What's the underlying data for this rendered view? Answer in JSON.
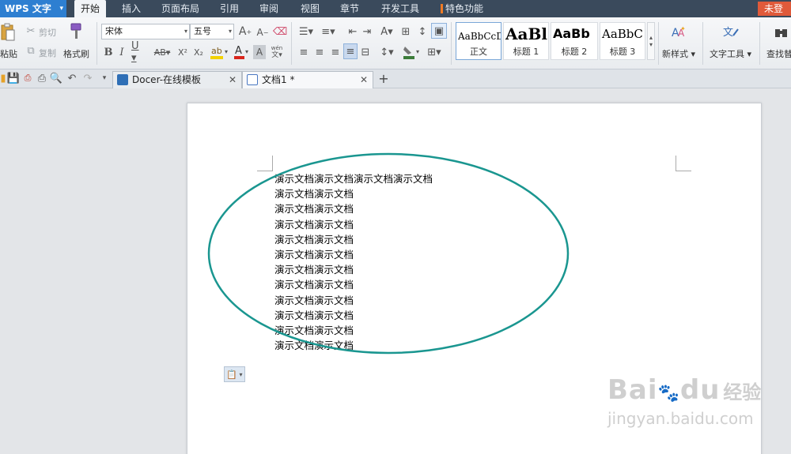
{
  "app": {
    "name": "WPS 文字",
    "login_label": "未登录"
  },
  "menu": {
    "tabs": [
      "开始",
      "插入",
      "页面布局",
      "引用",
      "审阅",
      "视图",
      "章节",
      "开发工具",
      "特色功能"
    ],
    "active": "开始"
  },
  "ribbon": {
    "clipboard": {
      "paste": "粘贴",
      "cut": "剪切",
      "copy": "复制",
      "format_painter": "格式刷"
    },
    "font": {
      "name": "宋体",
      "size": "五号"
    },
    "styles": [
      {
        "preview": "AaBbCcDd",
        "name": "正文"
      },
      {
        "preview": "AaBl",
        "name": "标题 1"
      },
      {
        "preview": "AaBb",
        "name": "标题 2"
      },
      {
        "preview": "AaBbC",
        "name": "标题 3"
      }
    ],
    "new_style": "新样式",
    "text_tools": "文字工具",
    "find_replace": "查找替"
  },
  "tabs": [
    {
      "label": "Docer-在线模板",
      "active": false
    },
    {
      "label": "文档1 *",
      "active": true
    }
  ],
  "document": {
    "lines": [
      "演示文档演示文档演示文档演示文档",
      "演示文档演示文档",
      "演示文档演示文档",
      "演示文档演示文档",
      "演示文档演示文档",
      "演示文档演示文档",
      "演示文档演示文档",
      "演示文档演示文档",
      "演示文档演示文档",
      "演示文档演示文档",
      "演示文档演示文档",
      "演示文档演示文档"
    ],
    "ellipse_color": "#1a9690"
  },
  "watermark": {
    "brand": "Bai",
    "brand2": "du",
    "cn": "经验",
    "url": "jingyan.baidu.com"
  },
  "colors": {
    "menubar": "#3a4a5c",
    "app_button": "#2e7fd1",
    "login": "#e05a3a",
    "special_mark": "#f07b25"
  }
}
